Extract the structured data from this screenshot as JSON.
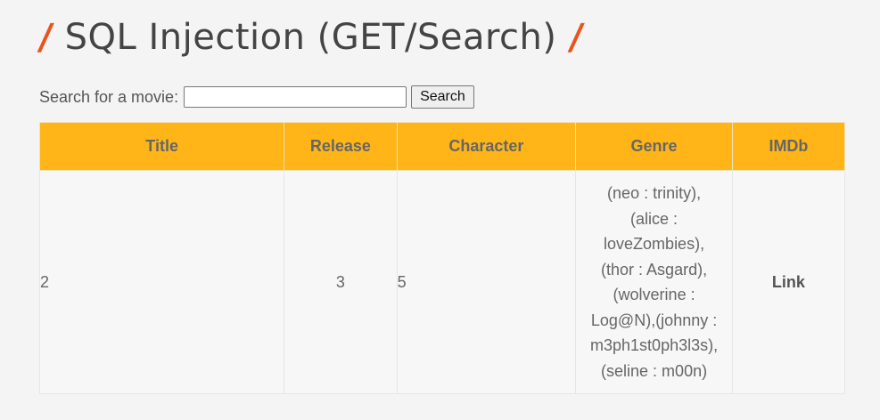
{
  "header": {
    "slash_left": "/",
    "title": "SQL Injection (GET/Search)",
    "slash_right": "/"
  },
  "search": {
    "label": "Search for a movie:",
    "value": "",
    "placeholder": "",
    "button_label": "Search"
  },
  "table": {
    "headers": [
      "Title",
      "Release",
      "Character",
      "Genre",
      "IMDb"
    ],
    "row": {
      "title": "2",
      "release": "3",
      "character": "5",
      "genre_lines": [
        "(neo : trinity),",
        "(alice :",
        "loveZombies),",
        "(thor : Asgard),",
        "(wolverine :",
        "Log@N),(johnny :",
        "m3ph1st0ph3l3s),",
        "(seline : m00n)"
      ],
      "imdb_link": "Link"
    }
  },
  "colors": {
    "accent_slash": "#e8541d",
    "table_header": "#ffb517",
    "background": "#f4f4f4"
  }
}
